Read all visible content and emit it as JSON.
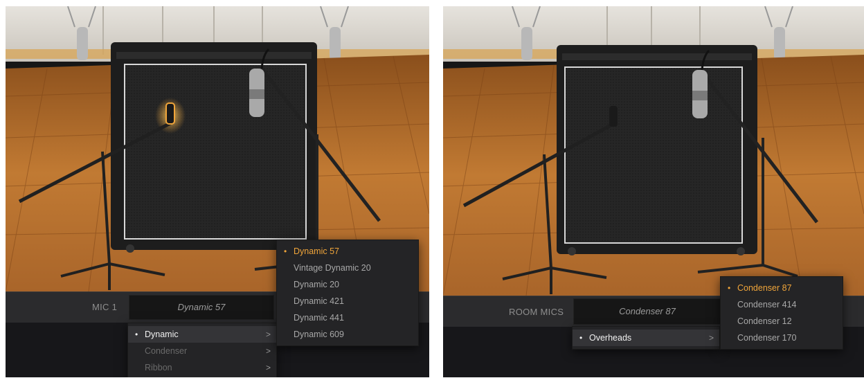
{
  "left_panel": {
    "mic_label": "MIC 1",
    "mic_value": "Dynamic 57",
    "category_menu": [
      {
        "label": "Dynamic",
        "selected": true,
        "bullet": "•",
        "chevron": ">"
      },
      {
        "label": "Condenser",
        "selected": false,
        "chevron": ">"
      },
      {
        "label": "Ribbon",
        "selected": false,
        "chevron": ">"
      }
    ],
    "model_menu": [
      {
        "label": "Dynamic 57",
        "selected": true,
        "bullet": "•"
      },
      {
        "label": "Vintage Dynamic 20",
        "selected": false
      },
      {
        "label": "Dynamic 20",
        "selected": false
      },
      {
        "label": "Dynamic 421",
        "selected": false
      },
      {
        "label": "Dynamic 441",
        "selected": false
      },
      {
        "label": "Dynamic 609",
        "selected": false
      }
    ]
  },
  "right_panel": {
    "mic_label": "ROOM MICS",
    "mic_value": "Condenser 87",
    "category_menu": [
      {
        "label": "Overheads",
        "selected": true,
        "bullet": "•",
        "chevron": ">"
      }
    ],
    "model_menu": [
      {
        "label": "Condenser 87",
        "selected": true,
        "bullet": "•"
      },
      {
        "label": "Condenser 414",
        "selected": false
      },
      {
        "label": "Condenser 12",
        "selected": false
      },
      {
        "label": "Condenser 170",
        "selected": false
      }
    ]
  },
  "colors": {
    "accent": "#f0a53a",
    "menu_bg": "#242426",
    "bar_bg": "#2b2b2d",
    "floor": "#b8702c",
    "amp": "#232323"
  }
}
